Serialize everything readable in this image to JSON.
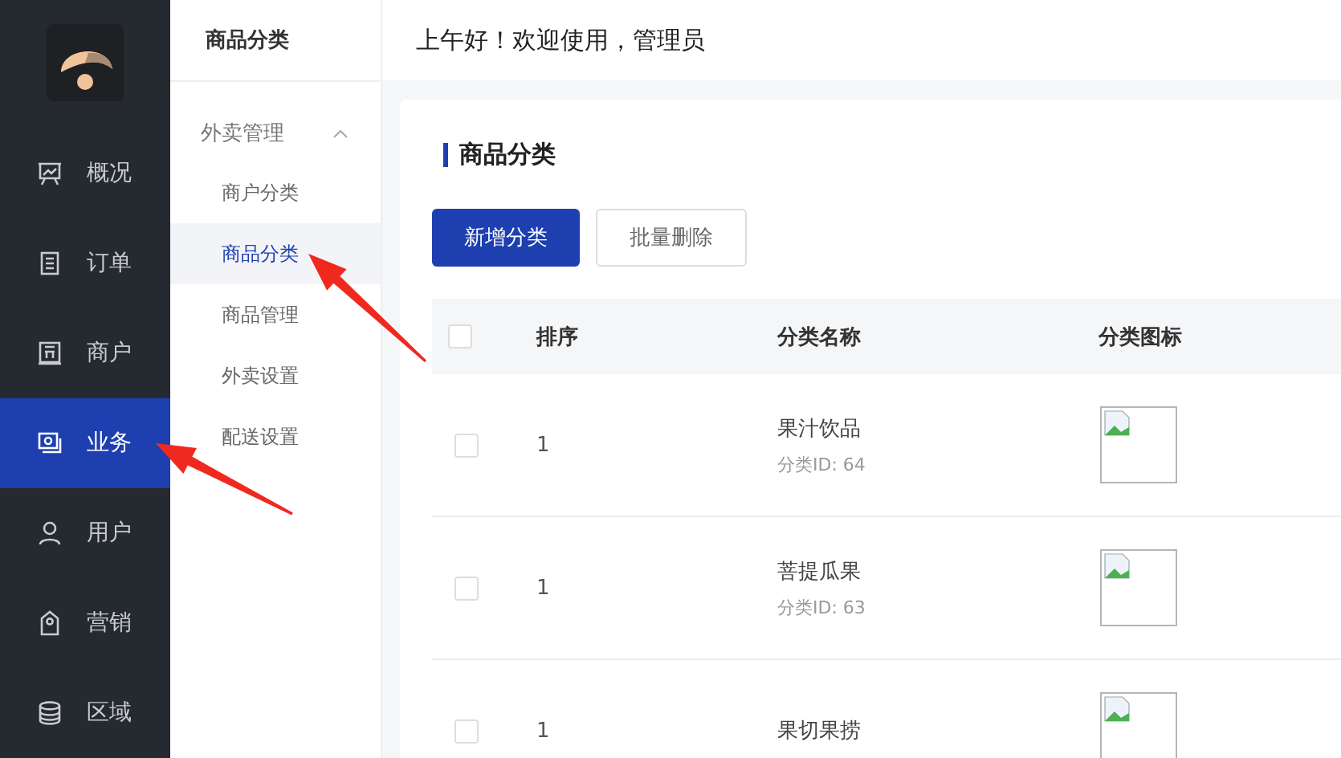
{
  "sidebar": {
    "items": [
      {
        "label": "概况",
        "selected": false
      },
      {
        "label": "订单",
        "selected": false
      },
      {
        "label": "商户",
        "selected": false
      },
      {
        "label": "业务",
        "selected": true
      },
      {
        "label": "用户",
        "selected": false
      },
      {
        "label": "营销",
        "selected": false
      },
      {
        "label": "区域",
        "selected": false
      }
    ]
  },
  "submenu": {
    "title": "商品分类",
    "group": {
      "label": "外卖管理",
      "expanded": true,
      "items": [
        {
          "label": "商户分类",
          "selected": false
        },
        {
          "label": "商品分类",
          "selected": true
        },
        {
          "label": "商品管理",
          "selected": false
        },
        {
          "label": "外卖设置",
          "selected": false
        },
        {
          "label": "配送设置",
          "selected": false
        }
      ]
    }
  },
  "header": {
    "greeting": "上午好！欢迎使用，管理员"
  },
  "card": {
    "title": "商品分类",
    "buttons": [
      {
        "label": "新增分类",
        "kind": "primary"
      },
      {
        "label": "批量删除",
        "kind": "default"
      }
    ],
    "table": {
      "columns": [
        "排序",
        "分类名称",
        "分类图标"
      ],
      "header_checked": false,
      "rows": [
        {
          "checked": false,
          "sort": "1",
          "name": "果汁饮品",
          "id_text": "分类ID: 64"
        },
        {
          "checked": false,
          "sort": "1",
          "name": "菩提瓜果",
          "id_text": "分类ID: 63"
        },
        {
          "checked": false,
          "sort": "1",
          "name": "果切果捞"
        }
      ]
    }
  }
}
